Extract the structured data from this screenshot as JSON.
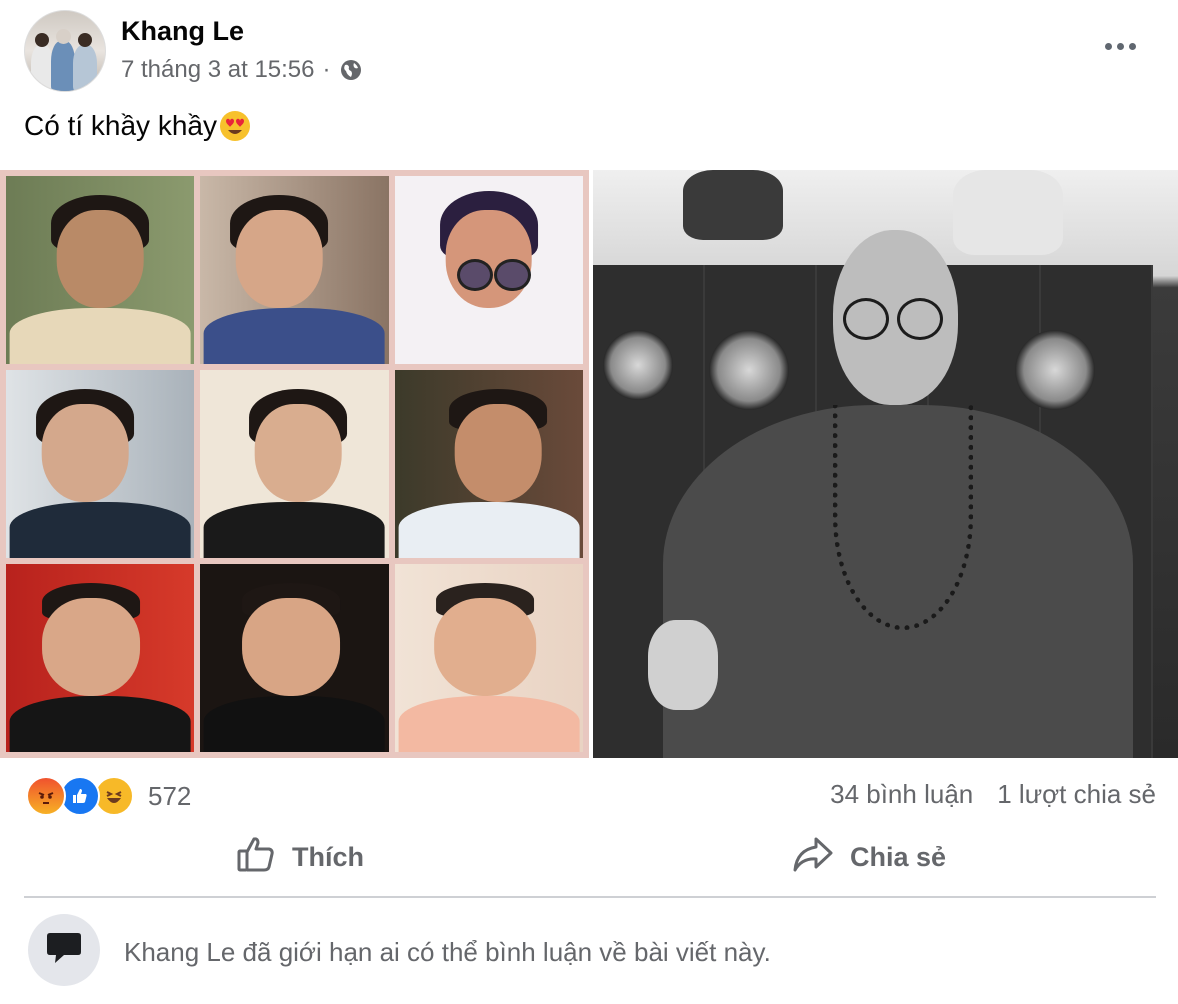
{
  "post": {
    "author": "Khang Le",
    "timestamp": "7 tháng 3 at 15:56",
    "separator": "·",
    "privacy_icon": "globe-icon",
    "more_icon": "more-horizontal-icon",
    "caption": "Có tí khầy khầy",
    "caption_emoji": "heart-eyes-emoji"
  },
  "media": {
    "collage_tiles": 9,
    "main_photo": "black-and-white-portrait"
  },
  "reactions": {
    "icons": [
      "angry-reaction-icon",
      "like-reaction-icon",
      "haha-reaction-icon"
    ],
    "count": "572"
  },
  "stats": {
    "comments": "34 bình luận",
    "shares": "1 lượt chia sẻ"
  },
  "actions": {
    "like_label": "Thích",
    "share_label": "Chia sẻ"
  },
  "notice": {
    "text": "Khang Le đã giới hạn ai có thể bình luận về bài viết này."
  },
  "colors": {
    "accent": "#1877f2",
    "secondary_text": "#65676b",
    "collage_border": "#e8c7c0"
  }
}
